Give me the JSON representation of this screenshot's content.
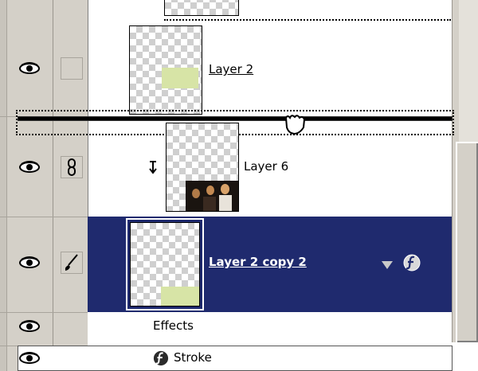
{
  "layers_panel": {
    "layers": [
      {
        "name": "",
        "selected": false
      },
      {
        "name": "Layer 2",
        "selected": false
      },
      {
        "name": "Layer 6",
        "selected": false,
        "clipped": true
      },
      {
        "name": "Layer 2 copy 2",
        "selected": true
      }
    ],
    "effects_label": "Effects",
    "effect_items": [
      {
        "name": "Stroke"
      }
    ]
  },
  "icons": {
    "visibility": "eye-icon",
    "link": "chain-link-icon",
    "brush": "brush-icon",
    "clip": "clip-arrow-icon",
    "fx_collapse": "triangle-down-icon",
    "fx": "fx-icon",
    "cursor": "hand-grab-icon"
  },
  "colors": {
    "selected_row": "#1f2a6e",
    "panel_gray": "#d4d0c8",
    "mask_green": "#d7e4a6"
  }
}
